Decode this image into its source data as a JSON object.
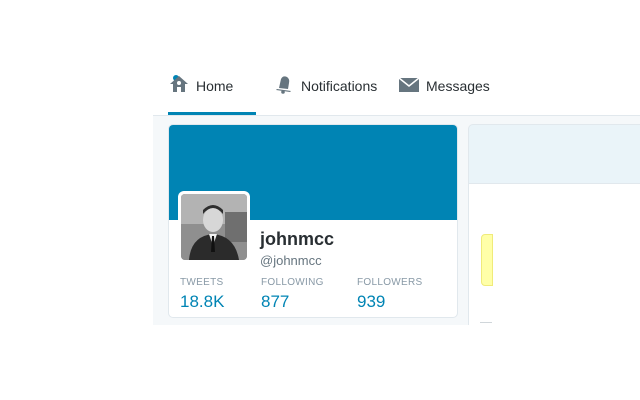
{
  "nav": {
    "home_label": "Home",
    "notifications_label": "Notifications",
    "messages_label": "Messages",
    "accent_color": "#0084b4"
  },
  "profile": {
    "name": "johnmcc",
    "handle": "@johnmcc",
    "banner_color": "#0084b4",
    "stats": {
      "tweets_label": "TWEETS",
      "tweets_value": "18.8K",
      "following_label": "FOLLOWING",
      "following_value": "877",
      "followers_label": "FOLLOWERS",
      "followers_value": "939"
    }
  }
}
